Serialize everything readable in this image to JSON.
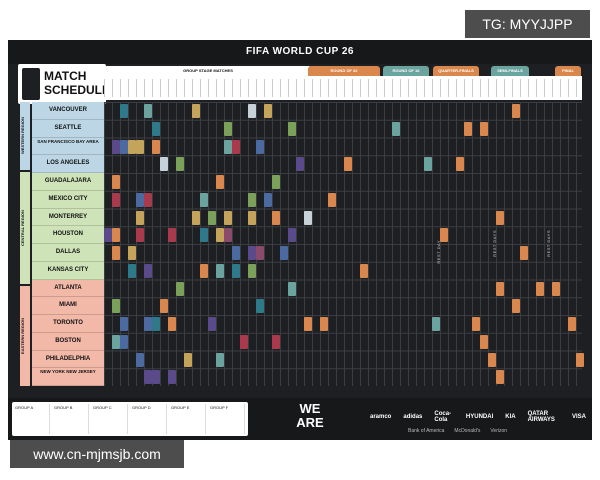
{
  "watermark_top": "TG: MYYJJPP",
  "watermark_bottom": "www.cn-mjmsjb.com",
  "poster": {
    "title": "FIFA WORLD CUP 26",
    "logo_line1": "MATCH",
    "logo_line2": "SCHEDULE",
    "stages": {
      "group": "GROUP STAGE MATCHES",
      "r32": "ROUND OF 32",
      "r16": "ROUND OF 16",
      "qf": "QUARTER-FINALS",
      "sf": "SEMI-FINALS",
      "final": "FINAL"
    },
    "regions": {
      "western": "WESTERN REGION",
      "central": "CENTRAL REGION",
      "eastern": "EASTERN REGION"
    },
    "cities": [
      {
        "name": "VANCOUVER",
        "region": "w"
      },
      {
        "name": "SEATTLE",
        "region": "w"
      },
      {
        "name": "SAN FRANCISCO BAY AREA",
        "region": "w"
      },
      {
        "name": "LOS ANGELES",
        "region": "w"
      },
      {
        "name": "GUADALAJARA",
        "region": "c"
      },
      {
        "name": "MEXICO CITY",
        "region": "c"
      },
      {
        "name": "MONTERREY",
        "region": "c"
      },
      {
        "name": "HOUSTON",
        "region": "c"
      },
      {
        "name": "DALLAS",
        "region": "c"
      },
      {
        "name": "KANSAS CITY",
        "region": "c"
      },
      {
        "name": "ATLANTA",
        "region": "e"
      },
      {
        "name": "MIAMI",
        "region": "e"
      },
      {
        "name": "TORONTO",
        "region": "e"
      },
      {
        "name": "BOSTON",
        "region": "e"
      },
      {
        "name": "PHILADELPHIA",
        "region": "e"
      },
      {
        "name": "NEW YORK NEW JERSEY",
        "region": "e"
      }
    ],
    "rest_days": [
      "REST DAY",
      "REST DAYS",
      "REST DAYS"
    ],
    "wearefifa_line1": "WE",
    "wearefifa_line2": "ARE",
    "sponsors_row1": [
      "aramco",
      "adidas",
      "Coca-Cola",
      "HYUNDAI",
      "KIA",
      "QATAR AIRWAYS",
      "VISA"
    ],
    "sponsors_row2": [
      "Bank of America",
      "McDonald's",
      "Verizon"
    ],
    "groups": [
      "GROUP A",
      "GROUP B",
      "GROUP C",
      "GROUP D",
      "GROUP E",
      "GROUP F"
    ],
    "colors": {
      "background": "#1d1f22",
      "western": "#bcd6e6",
      "central": "#cfe3b8",
      "eastern": "#f2b8a8",
      "orange": "#d9874d",
      "teal": "#6ba39e"
    }
  }
}
